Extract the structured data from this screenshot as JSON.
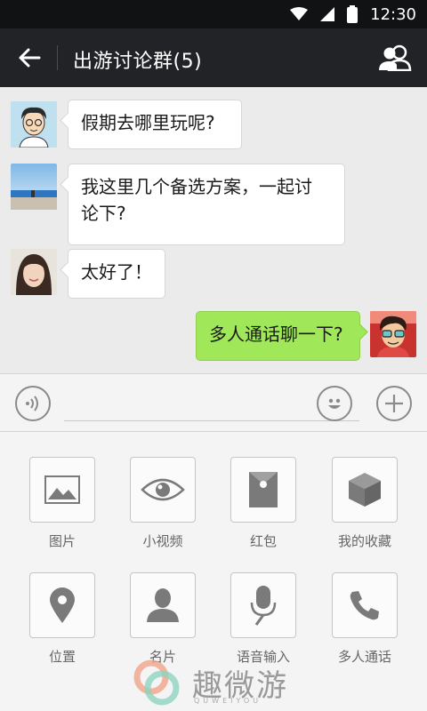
{
  "status_bar": {
    "time": "12:30"
  },
  "header": {
    "title": "出游讨论群(5)"
  },
  "messages": [
    {
      "text": "假期去哪里玩呢?",
      "mine": false
    },
    {
      "text_line1": "我这里几个备选方案，一起讨",
      "text_line2": "论下?",
      "mine": false
    },
    {
      "text": "太好了！",
      "mine": false
    },
    {
      "text": "多人通话聊一下?",
      "mine": true
    }
  ],
  "tools": [
    {
      "label": "图片",
      "icon": "image-icon"
    },
    {
      "label": "小视频",
      "icon": "eye-icon"
    },
    {
      "label": "红包",
      "icon": "red-envelope-icon"
    },
    {
      "label": "我的收藏",
      "icon": "cube-icon"
    },
    {
      "label": "位置",
      "icon": "location-pin-icon"
    },
    {
      "label": "名片",
      "icon": "person-icon"
    },
    {
      "label": "语音输入",
      "icon": "microphone-icon"
    },
    {
      "label": "多人通话",
      "icon": "phone-icon"
    }
  ],
  "watermark": {
    "text": "趣微游",
    "sub": "QUWEIYOU"
  },
  "colors": {
    "my_bubble": "#a0e75a",
    "titlebar": "#212326",
    "statusbar": "#101213"
  }
}
